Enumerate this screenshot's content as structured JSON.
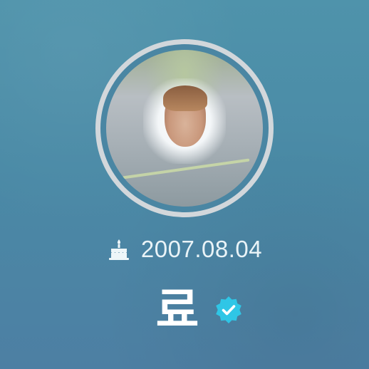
{
  "profile": {
    "birthday": "2007.08.04",
    "name": "료",
    "verified": true
  },
  "icons": {
    "birthday": "birthday-cake-icon",
    "verified": "verified-badge-icon"
  },
  "colors": {
    "background": "#4a8aa6",
    "ring": "#d2d7db",
    "text": "#ffffff",
    "verified": "#2fc6e6"
  }
}
